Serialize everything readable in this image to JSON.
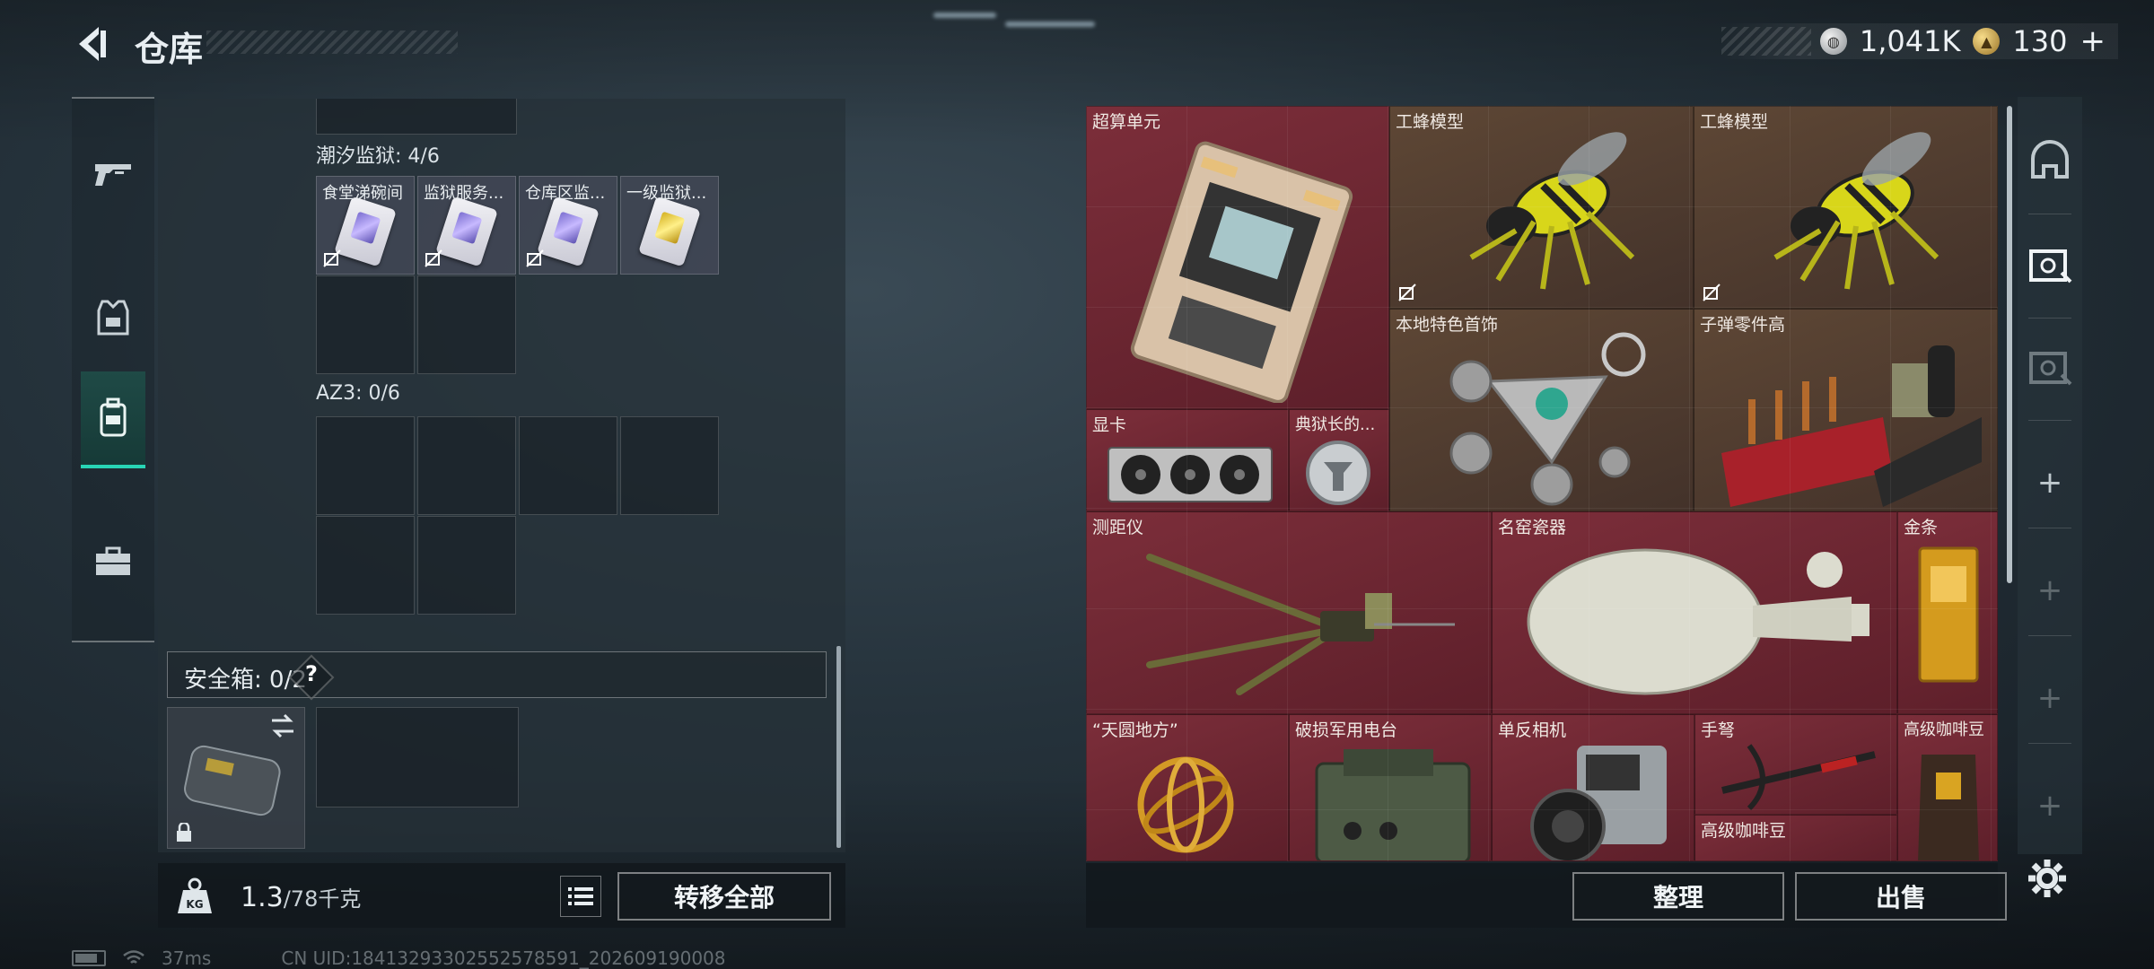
{
  "header": {
    "title": "仓库"
  },
  "currency": {
    "silver_value": "1,041K",
    "gold_value": "130"
  },
  "left_nav": {
    "items": [
      "weapon",
      "armor",
      "backpack",
      "toolbox"
    ]
  },
  "containers": [
    {
      "label": "潮汐监狱: 4/6",
      "items": [
        "食堂涕碗间",
        "监狱服务...",
        "仓库区监...",
        "一级监狱..."
      ]
    },
    {
      "label": "AZ3: 0/6"
    }
  ],
  "safe_box": {
    "label": "安全箱: 0/2",
    "help": "?"
  },
  "bottom_left": {
    "weight": "1.3",
    "capacity": "/78千克",
    "transfer_label": "转移全部"
  },
  "stash": {
    "items": [
      "超算单元",
      "工蜂模型",
      "工蜂模型",
      "本地特色首饰",
      "子弹零件高",
      "显卡",
      "典狱长的...",
      "测距仪",
      "名窑瓷器",
      "金条",
      "“天圆地方”",
      "破损军用电台",
      "单反相机",
      "手弩",
      "高级咖啡豆",
      "高级咖啡豆"
    ]
  },
  "bottom_right": {
    "sort_label": "整理",
    "sell_label": "出售"
  },
  "status_bar": {
    "ping": "37ms",
    "uid": "CN UID:18413293302552578591_202609190008"
  },
  "colors": {
    "accent": "#28d5b5",
    "stash_red": "#7c2e3a",
    "stash_brown": "#5e4735"
  }
}
